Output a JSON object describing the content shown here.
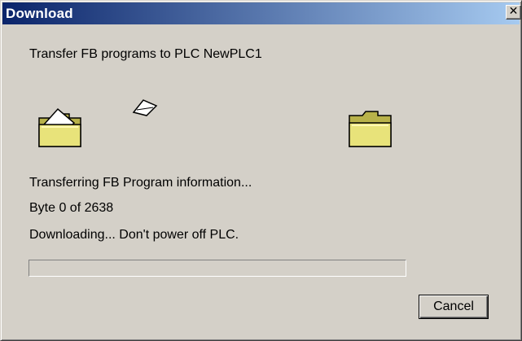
{
  "window": {
    "title": "Download",
    "close_glyph": "✕"
  },
  "message": "Transfer FB programs to PLC NewPLC1",
  "animation": {
    "source_icon": "folder-open-icon",
    "flying_icon": "document-icon",
    "target_icon": "folder-icon"
  },
  "status": {
    "line1": "Transferring FB Program information...",
    "line2": "Byte 0 of 2638",
    "line3": "Downloading... Don't power off PLC."
  },
  "progress": {
    "value": 0
  },
  "buttons": {
    "cancel": "Cancel"
  },
  "colors": {
    "face": "#d4d0c8",
    "title_start": "#0a246a",
    "title_end": "#a6caf0",
    "folder": "#e8e37a"
  }
}
